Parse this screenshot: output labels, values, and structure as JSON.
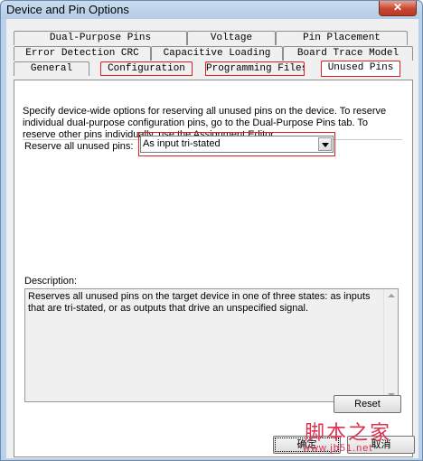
{
  "window": {
    "title": "Device and Pin Options",
    "close_label": "✕"
  },
  "tabs": {
    "row1": [
      {
        "label": "Dual-Purpose Pins"
      },
      {
        "label": "Voltage"
      },
      {
        "label": "Pin Placement"
      }
    ],
    "row2": [
      {
        "label": "Error Detection CRC"
      },
      {
        "label": "Capacitive Loading"
      },
      {
        "label": "Board Trace Model"
      }
    ],
    "row3": [
      {
        "label": "General"
      },
      {
        "label": "Configuration"
      },
      {
        "label": "Programming Files"
      },
      {
        "label": "Unused Pins"
      }
    ],
    "active": "Unused Pins"
  },
  "panel": {
    "intro": "Specify device-wide options for reserving all unused pins on the device. To reserve individual dual-purpose configuration pins, go to the Dual-Purpose Pins tab. To reserve other pins individually, use the Assignment Editor.",
    "reserve_label": "Reserve all unused pins:",
    "reserve_value": "As input tri-stated",
    "description_label": "Description:",
    "description_text": "Reserves all unused pins on the target device in one of three states: as inputs that are tri-stated, or as outputs that drive an unspecified signal."
  },
  "buttons": {
    "reset": "Reset",
    "ok": "确定",
    "cancel": "取消"
  },
  "watermark": {
    "text": "脚本之家",
    "url": "www.jb51.net"
  },
  "colors": {
    "highlight": "#e02020",
    "titlebar": "#b9d1ea",
    "watermark": "#e03050"
  }
}
